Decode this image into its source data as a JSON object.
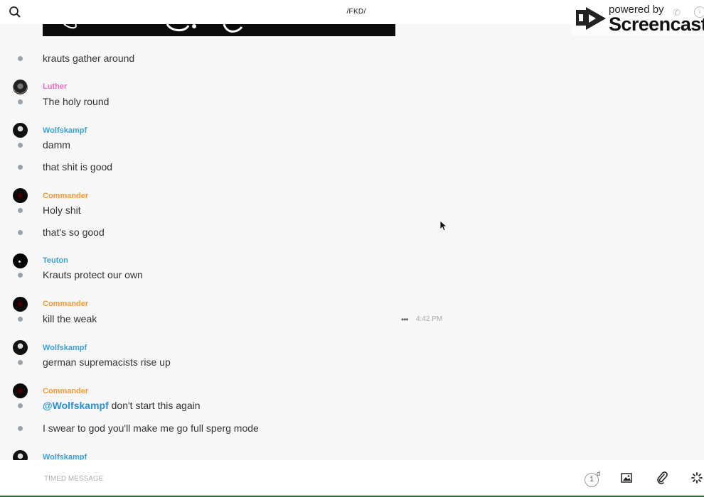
{
  "header": {
    "channel_title": "/FKD/",
    "search_icon": "search-icon"
  },
  "watermark": {
    "line1": "powered by",
    "line2": "Screencastify"
  },
  "messages": [
    {
      "user": "",
      "text": "krauts gather around"
    },
    {
      "user": "Luther",
      "text": "The holy round"
    },
    {
      "user": "Wolfskampf",
      "text": "damm"
    },
    {
      "user": "",
      "text": "that shit is good"
    },
    {
      "user": "Commander",
      "text": "Holy shit"
    },
    {
      "user": "",
      "text": "that's so good"
    },
    {
      "user": "Teuton",
      "text": "Krauts protect our own"
    },
    {
      "user": "Commander",
      "text": "kill the weak",
      "time": "4:42 PM"
    },
    {
      "user": "Wolfskampf",
      "text": "german supremacists rise up"
    },
    {
      "user": "Commander",
      "mention": "@Wolfskampf",
      "text": "don't start this again"
    },
    {
      "user": "",
      "text": "I swear to god you'll make me go full sperg mode"
    },
    {
      "user": "Wolfskampf",
      "text": ""
    }
  ],
  "composer": {
    "placeholder": "TIMED MESSAGE",
    "timer_value": "1",
    "timer_unit": "d"
  },
  "colors": {
    "luther": "#e86bbf",
    "wolfskampf": "#3f9fd5",
    "commander": "#f0993a",
    "teuton": "#3f9fd5"
  }
}
